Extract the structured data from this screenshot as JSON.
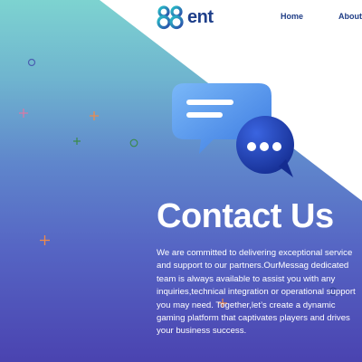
{
  "brand": {
    "logo_mark_text": "88",
    "logo_text": "ent"
  },
  "nav": {
    "items": [
      {
        "label": "Home"
      },
      {
        "label": "About"
      }
    ]
  },
  "hero": {
    "title": "Contact Us",
    "description": "We are committed to delivering exceptional service and support to our partners.OurMessag dedicated team is always available to assist you with any inquiries,technical integration or operational support you may need. Together,let’s create a dynamic gaming platform that captivates players and drives your business success.",
    "illustration": "chat-bubbles-icon"
  },
  "colors": {
    "gradient_top": "#7dd3d0",
    "gradient_bottom": "#4a43b0",
    "brand_blue": "#1e3f8a",
    "bubble_light": "#5aa0f0",
    "bubble_dark": "#1d3fb8"
  }
}
